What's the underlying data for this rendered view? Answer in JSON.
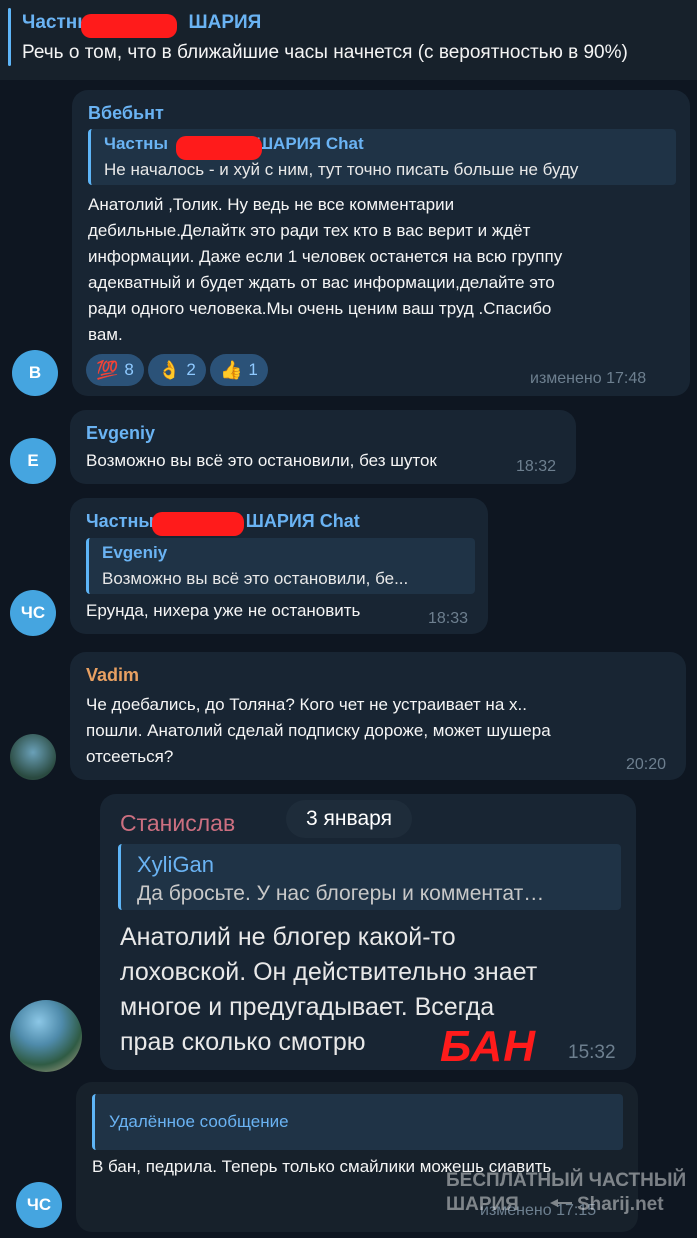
{
  "pinned": {
    "title_prefix": "Частны",
    "title_suffix": "ШАРИЯ",
    "text": "Речь о том, что в ближайшие часы начнется (с вероятностью в 90%)"
  },
  "messages": [
    {
      "avatar_letter": "В",
      "avatar_color": "#45a5e0",
      "sender": "Вбебьнт",
      "sender_color": "#6ab3f3",
      "reply_name_prefix": "Частны",
      "reply_name_suffix": "ШАРИЯ Chat",
      "reply_text": "Не началось - и хуй с ним, тут точно писать больше не буду",
      "lines": [
        "Анатолий ,Толик. Ну ведь не все комментарии",
        "дебильные.Делайтк это ради тех кто в вас верит и ждёт",
        "информации. Даже если 1 человек останется на всю группу",
        "адекватный и будет ждать от вас  информации,делайте это",
        "ради одного человека.Мы очень ценим ваш труд .Спасибо",
        "вам."
      ],
      "reactions": [
        {
          "icon": "💯",
          "icon_name": "hundred-points-icon",
          "count": "8"
        },
        {
          "icon": "👌",
          "icon_name": "ok-hand-icon",
          "count": "2"
        },
        {
          "icon": "👍",
          "icon_name": "thumbs-up-icon",
          "count": "1"
        }
      ],
      "time": "изменено 17:48"
    },
    {
      "avatar_letter": "E",
      "avatar_color": "#45a5e0",
      "sender": "Evgeniy",
      "sender_color": "#6ab3f3",
      "text": "Возможно вы всё это остановили, без шуток",
      "time": "18:32"
    },
    {
      "avatar_letter": "ЧС",
      "avatar_color": "#45a5e0",
      "sender_prefix": "Частны",
      "sender_suffix": "ШАРИЯ Chat",
      "sender_color": "#6ab3f3",
      "reply_name": "Evgeniy",
      "reply_text": "Возможно вы всё это остановили, бе...",
      "text": "Ерунда, нихера уже не остановить",
      "time": "18:33"
    },
    {
      "sender": "Vadim",
      "sender_color": "#e8a062",
      "lines": [
        "Че доебались, до Толяна? Кого чет не устраивает на х..",
        "пошли. Анатолий сделай подписку дороже, может шушера",
        "отсееться?"
      ],
      "time": "20:20"
    },
    {
      "sender": "Станислав",
      "sender_color": "#cc6f80",
      "date": "3 января",
      "reply_name": "XyliGan",
      "reply_text": "Да бросьте. У нас блогеры и комментат…",
      "lines": [
        "Анатолий не блогер какой-то",
        "лоховской. Он действительно знает",
        "многое и предугадывает. Всегда",
        "прав сколько смотрю"
      ],
      "stamp": "БАН",
      "time": "15:32"
    },
    {
      "avatar_letter": "ЧС",
      "avatar_color": "#45a5e0",
      "reply_text": "Удалённое сообщение",
      "text": "В бан, педрила. Теперь только смайлики можешь сиавить",
      "time": "изменено 17:15"
    }
  ],
  "watermark": {
    "line1": "БЕСПЛАТНЫЙ ЧАСТНЫЙ",
    "line2_left": "ШАРИЯ",
    "line2_right": "Sharij.net"
  }
}
